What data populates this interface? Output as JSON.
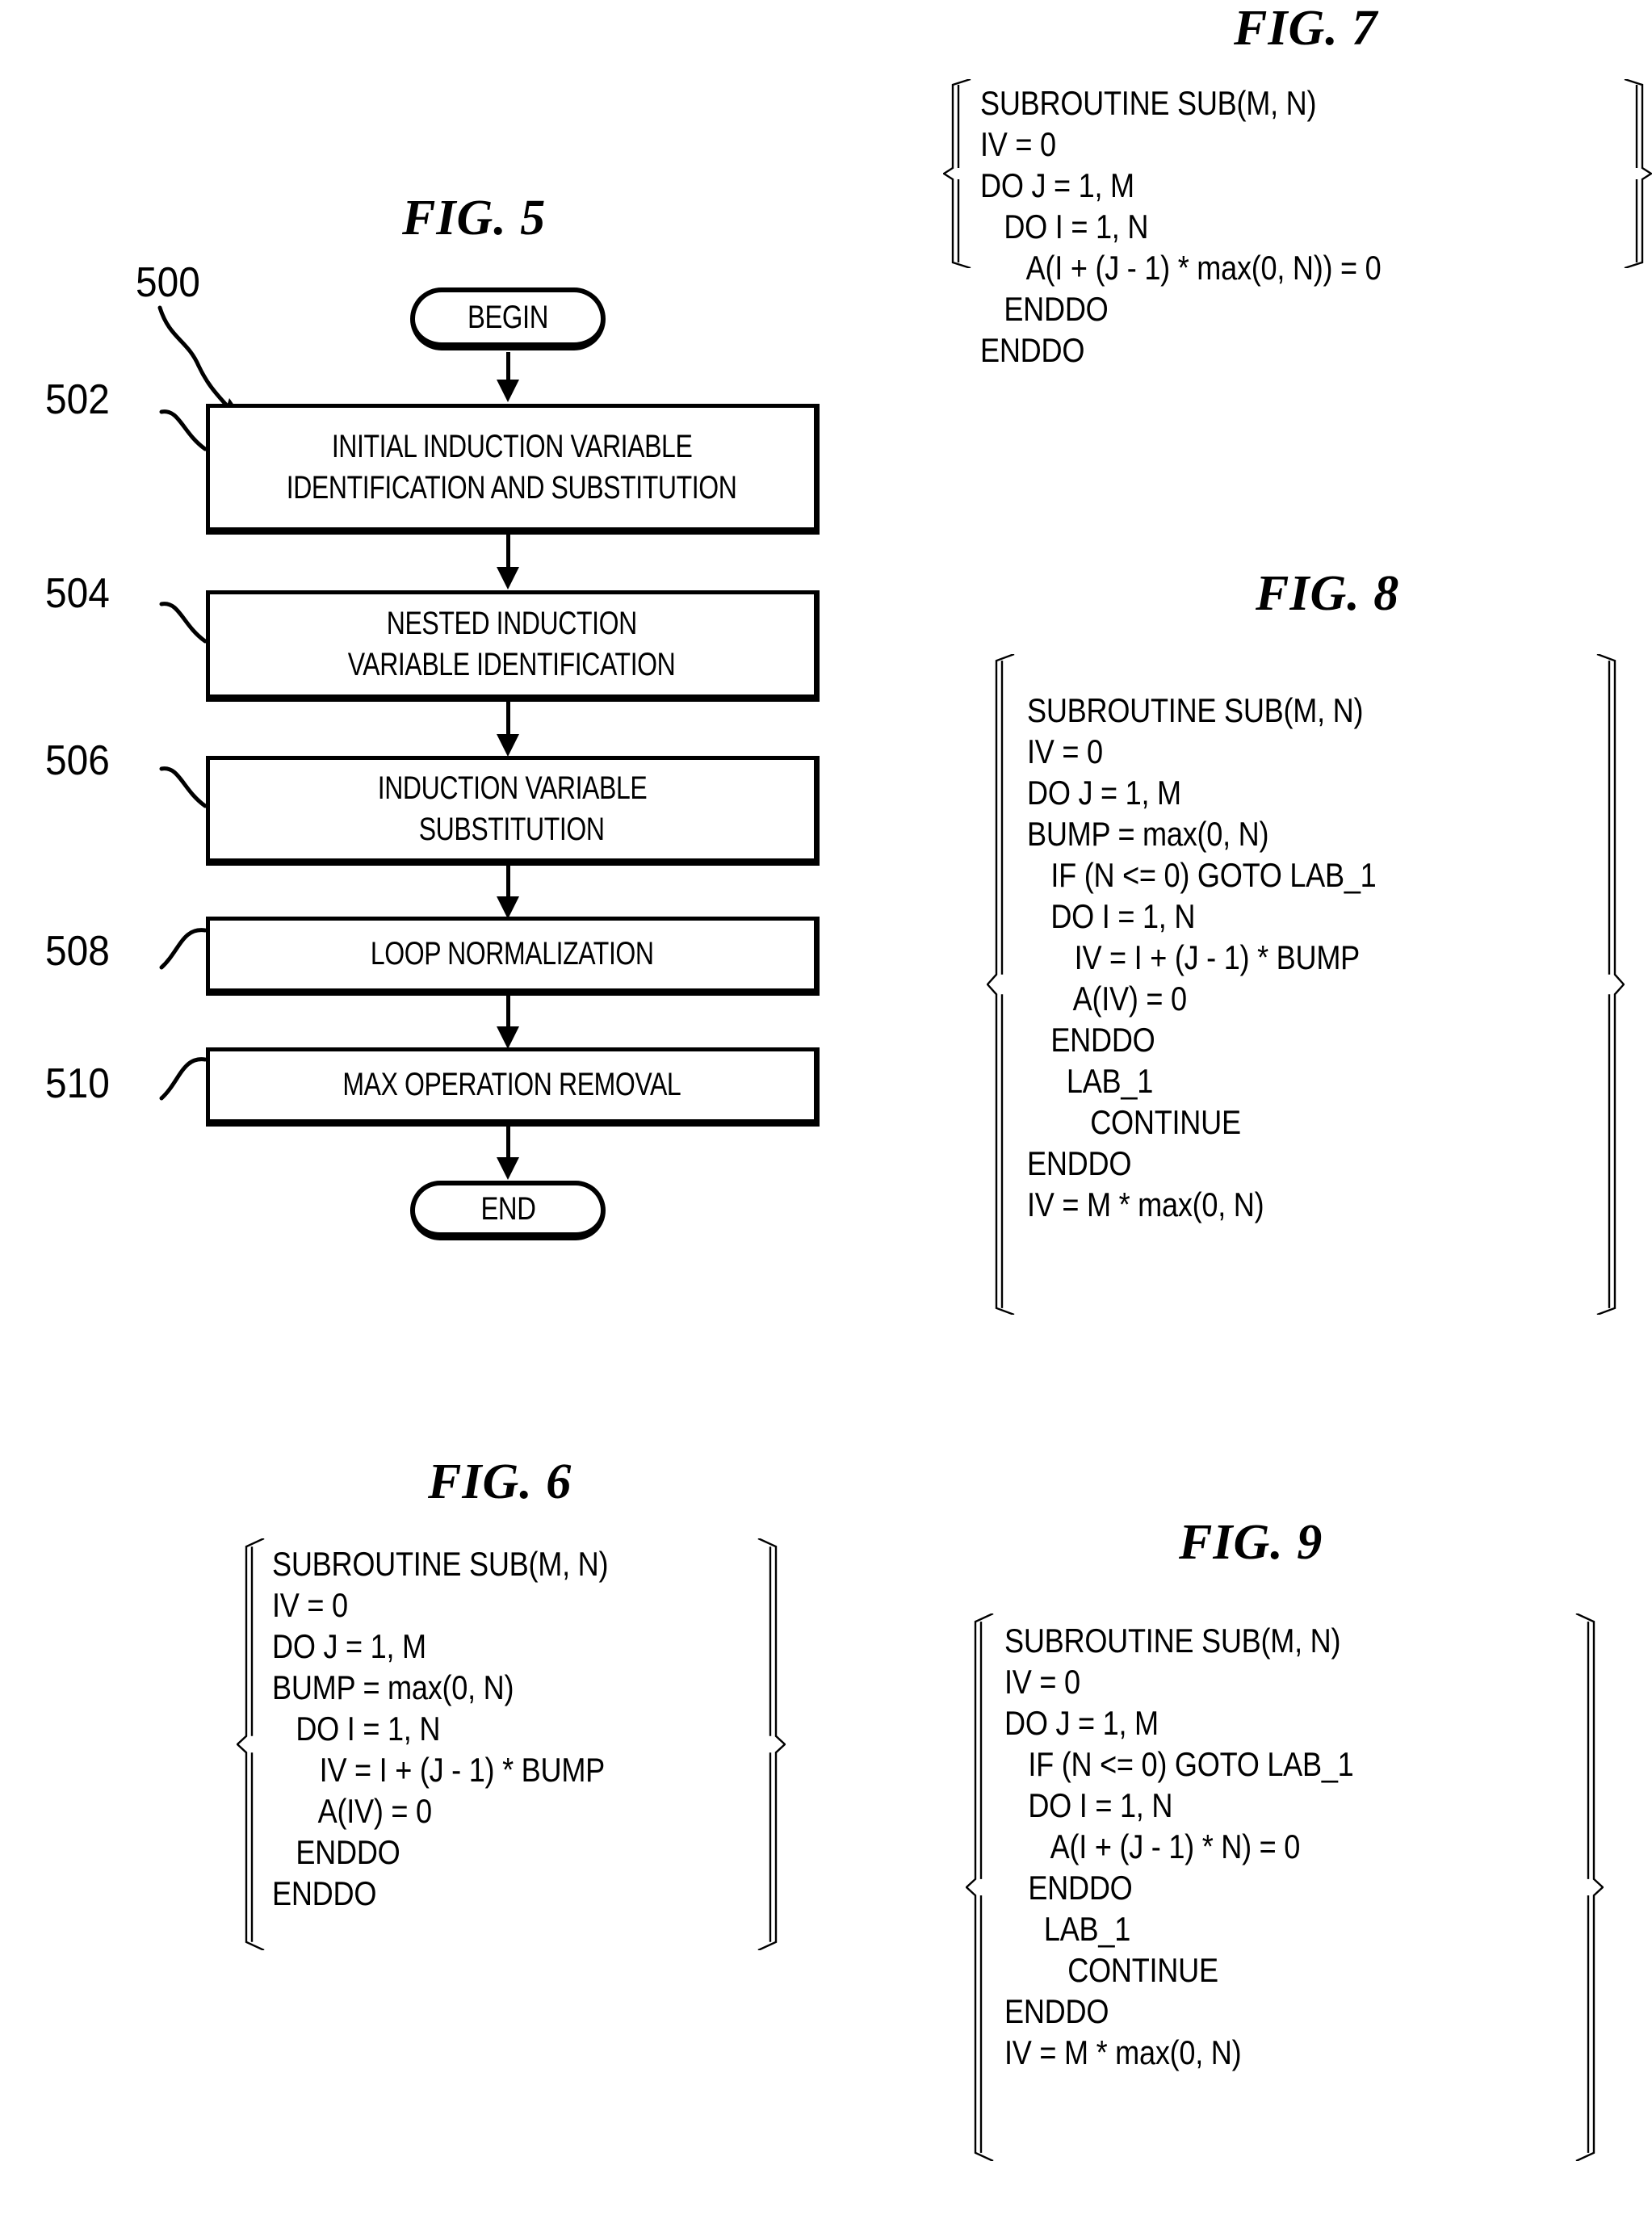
{
  "sheet": {
    "background": "#ffffff",
    "ink": "#000000"
  },
  "figures": {
    "fig5": {
      "title": "FIG. 5",
      "reference_numeral": "500",
      "begin_label": "BEGIN",
      "end_label": "END",
      "steps": [
        {
          "ref": "502",
          "lines": [
            "INITIAL INDUCTION VARIABLE",
            "IDENTIFICATION AND SUBSTITUTION"
          ]
        },
        {
          "ref": "504",
          "lines": [
            "NESTED INDUCTION",
            "VARIABLE IDENTIFICATION"
          ]
        },
        {
          "ref": "506",
          "lines": [
            "INDUCTION VARIABLE",
            "SUBSTITUTION"
          ]
        },
        {
          "ref": "508",
          "lines": [
            "LOOP NORMALIZATION"
          ]
        },
        {
          "ref": "510",
          "lines": [
            "MAX OPERATION REMOVAL"
          ]
        }
      ]
    },
    "fig6": {
      "title": "FIG. 6",
      "code": "SUBROUTINE SUB(M, N)\nIV = 0\nDO J = 1, M\nBUMP = max(0, N)\n   DO I = 1, N\n      IV = I + (J - 1) * BUMP\n      A(IV) = 0\n   ENDDO\nENDDO"
    },
    "fig7": {
      "title": "FIG. 7",
      "code": "SUBROUTINE SUB(M, N)\nIV = 0\nDO J = 1, M\n   DO I = 1, N\n      A(I + (J - 1) * max(0, N)) = 0\n   ENDDO\nENDDO"
    },
    "fig8": {
      "title": "FIG. 8",
      "code": "SUBROUTINE SUB(M, N)\nIV = 0\nDO J = 1, M\nBUMP = max(0, N)\n   IF (N <= 0) GOTO LAB_1\n   DO I = 1, N\n      IV = I + (J - 1) * BUMP\n      A(IV) = 0\n   ENDDO\n     LAB_1\n        CONTINUE\nENDDO\nIV = M * max(0, N)"
    },
    "fig9": {
      "title": "FIG. 9",
      "code": "SUBROUTINE SUB(M, N)\nIV = 0\nDO J = 1, M\n   IF (N <= 0) GOTO LAB_1\n   DO I = 1, N\n      A(I + (J - 1) * N) = 0\n   ENDDO\n     LAB_1\n        CONTINUE\nENDDO\nIV = M * max(0, N)"
    }
  }
}
